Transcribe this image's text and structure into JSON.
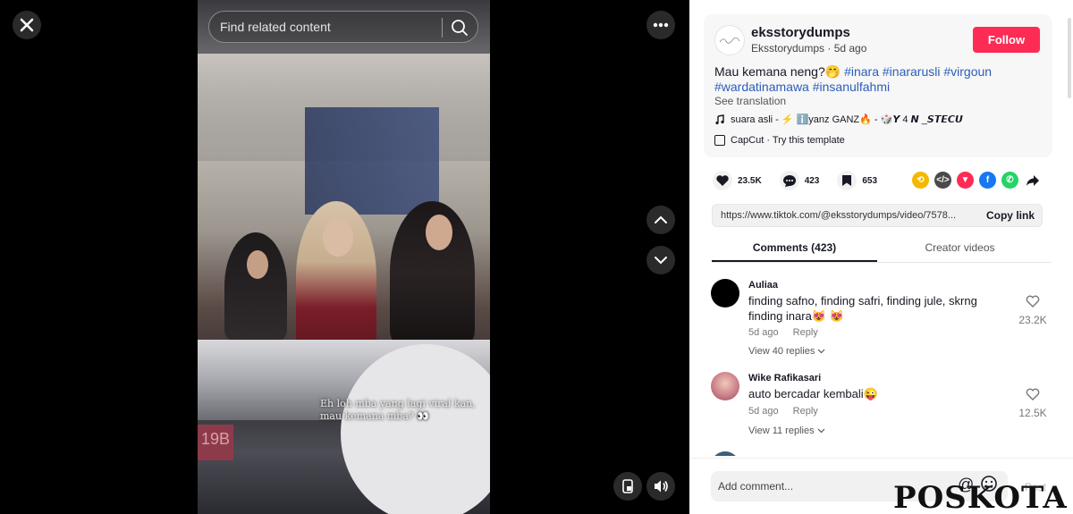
{
  "video": {
    "search_placeholder": "Find related content",
    "caption": "Eh loh mba yang lagi viral kan,\nmau kemana mba? 👀",
    "sign_text": "19B"
  },
  "post": {
    "author_name": "eksstorydumps",
    "author_sub": "Eksstorydumps · 5d ago",
    "follow_label": "Follow",
    "description_text": "Mau kemana neng?🤭",
    "hashtags": [
      "#inara",
      "#inararusli",
      "#virgoun",
      "#wardatinamawa",
      "#insanulfahmi"
    ],
    "see_translation": "See translation",
    "music": "suara asli - ⚡ ℹ️yanz GANZ🔥 - 🎲𝙔 4 𝙉 _𝙎𝙏𝙀𝘾𝙐",
    "capcut": "CapCut · Try this template"
  },
  "stats": {
    "likes": "23.5K",
    "comments": "423",
    "saves": "653"
  },
  "link": {
    "url": "https://www.tiktok.com/@eksstorydumps/video/7578...",
    "copy_label": "Copy link"
  },
  "tabs": {
    "comments": "Comments (423)",
    "creator": "Creator videos"
  },
  "comments": [
    {
      "user": "Auliaa",
      "text": "finding safno, finding safri, finding jule, skrng finding inara😻 😻",
      "time": "5d ago",
      "reply": "Reply",
      "replies": "View 40 replies",
      "likes": "23.2K",
      "avatar_color": "#000000"
    },
    {
      "user": "Wike Rafikasari",
      "text": "auto bercadar kembali😜",
      "time": "5d ago",
      "reply": "Reply",
      "replies": "View 11 replies",
      "likes": "12.5K",
      "avatar_color": "#c97a86"
    }
  ],
  "bottom": {
    "comment_placeholder": "Add comment...",
    "post_label": "Post",
    "watermark": "POSKOTA"
  },
  "colors": {
    "accent": "#fe2c55",
    "hashtag": "#2b5db9"
  },
  "icons": {
    "share": [
      "repost-icon",
      "embed-icon",
      "send-icon",
      "facebook-icon",
      "whatsapp-icon",
      "share-arrow-icon"
    ]
  }
}
